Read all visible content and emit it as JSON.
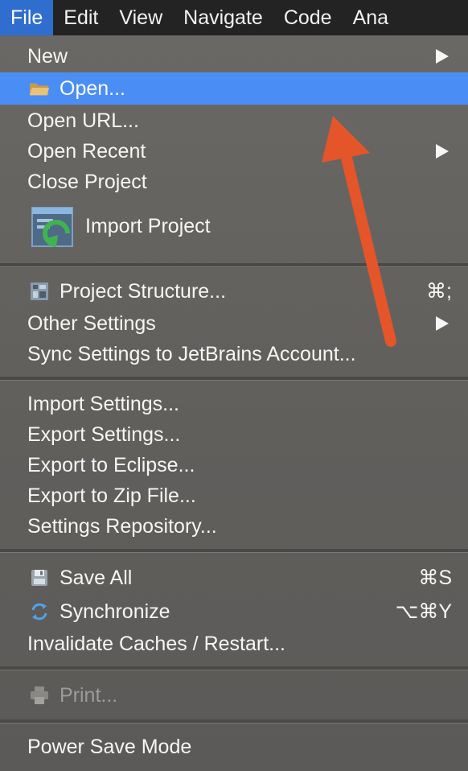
{
  "menubar": {
    "items": [
      {
        "label": "File",
        "active": true
      },
      {
        "label": "Edit"
      },
      {
        "label": "View"
      },
      {
        "label": "Navigate"
      },
      {
        "label": "Code"
      },
      {
        "label": "Ana"
      }
    ]
  },
  "menu": {
    "items": [
      {
        "label": "New",
        "submenu": true
      },
      {
        "label": "Open...",
        "selected": true,
        "icon": "folder-icon"
      },
      {
        "label": "Open URL..."
      },
      {
        "label": "Open Recent",
        "submenu": true
      },
      {
        "label": "Close Project"
      },
      {
        "label": "Import Project",
        "icon": "import-project-icon"
      },
      {
        "label": "Project Structure...",
        "icon": "project-structure-icon",
        "shortcut": "⌘;"
      },
      {
        "label": "Other Settings",
        "submenu": true
      },
      {
        "label": "Sync Settings to JetBrains Account..."
      },
      {
        "label": "Import Settings..."
      },
      {
        "label": "Export Settings..."
      },
      {
        "label": "Export to Eclipse..."
      },
      {
        "label": "Export to Zip File..."
      },
      {
        "label": "Settings Repository..."
      },
      {
        "label": "Save All",
        "icon": "save-icon",
        "shortcut": "⌘S"
      },
      {
        "label": "Synchronize",
        "icon": "sync-icon",
        "shortcut": "⌥⌘Y"
      },
      {
        "label": "Invalidate Caches / Restart..."
      },
      {
        "label": "Print...",
        "icon": "printer-icon",
        "disabled": true
      },
      {
        "label": "Power Save Mode"
      }
    ]
  },
  "colors": {
    "menubar_bg": "#232323",
    "menubar_active": "#2f6ecf",
    "selection": "#4a8ef5",
    "annotation_arrow": "#e4552a"
  }
}
